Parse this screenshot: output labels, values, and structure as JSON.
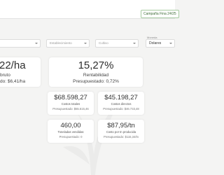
{
  "header": {
    "campaign_badge": "Campaña Fina 24/25"
  },
  "page_title": "",
  "filters": [
    {
      "placeholder": "",
      "value": ""
    },
    {
      "placeholder": "Establecimiento",
      "value": ""
    },
    {
      "placeholder": "Cultivo",
      "value": ""
    },
    {
      "label": "Moneda",
      "value": "Dolares"
    }
  ],
  "kpis": {
    "margin": {
      "value": "22/ha",
      "label": "bruto",
      "sub": "do: $6,41/ha"
    },
    "profitability": {
      "value": "15,27%",
      "label": "Rentabilidad",
      "sub": "Presupuestado: 0,72%"
    }
  },
  "stats": [
    {
      "value": "$68.598,27",
      "label": "Costos totales",
      "sub": "Presupuestado: $55.615,46"
    },
    {
      "value": "$45.198,27",
      "label": "Costos directos",
      "sub": "Presupuestado: $46.733,48"
    },
    {
      "value": "460,00",
      "label": "Toneladas vendidas",
      "sub": "Presupuestado: 0"
    },
    {
      "value": "$87,95/tn",
      "label": "Costo por tn producida",
      "sub": "Presupuestado: $115,34/tn"
    }
  ]
}
